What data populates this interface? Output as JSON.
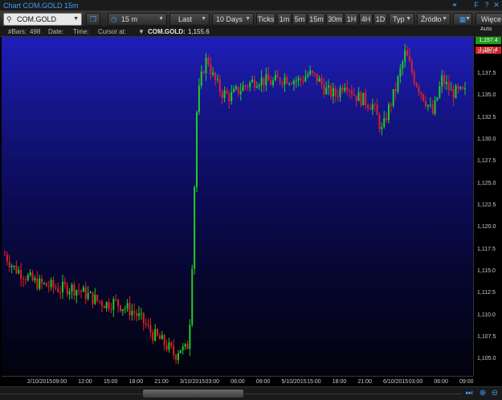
{
  "window": {
    "title": "Chart COM.GOLD 15m"
  },
  "toolbar": {
    "symbol": "COM.GOLD",
    "interval": "15 m",
    "price_type": "Last",
    "range": "10 Days",
    "ticks": "Ticks",
    "intervals": [
      "1m",
      "5m",
      "15m",
      "30m",
      "1H",
      "4H",
      "1D"
    ],
    "typ": "Typ",
    "source": "Źródło",
    "more": "Więce"
  },
  "infobar": {
    "bars_label": "#Bars:",
    "bars_value": "498",
    "date_label": "Date:",
    "time_label": "Time:",
    "cursor_label": "Cursor at:",
    "symbol": "COM.GOLD:",
    "symbol_value": "1,155.6"
  },
  "axis": {
    "auto": "Auto",
    "last_price_green": "1,157.4",
    "last_price_red": "1,157.4"
  },
  "colors": {
    "bull": "#22cc22",
    "bear": "#dd2222"
  },
  "chart_data": {
    "type": "candlestick",
    "y_ticks": [
      1105,
      1107.5,
      1110,
      1112.5,
      1115,
      1117.5,
      1120,
      1122.5,
      1125,
      1127.5,
      1130,
      1132.5,
      1135,
      1137.5,
      1140
    ],
    "y_tick_labels": [
      "1,105.0",
      "1,107.5",
      "1,110.0",
      "1,112.5",
      "1,115.0",
      "1,117.5",
      "1,120.0",
      "1,122.5",
      "1,125.0",
      "1,127.5",
      "1,130.0",
      "1,132.5",
      "1,135.0",
      "1,137.5",
      "1,140.0"
    ],
    "ylim": [
      1103.2,
      1141.8
    ],
    "x_tick_labels": [
      "2/10/2015",
      "09:00",
      "12:00",
      "15:00",
      "18:00",
      "21:00",
      "3/10/2015",
      "03:00",
      "06:00",
      "09:00",
      "5/10/2015",
      "15:00",
      "18:00",
      "21:00",
      "6/10/2015",
      "03:00",
      "06:00",
      "09:00"
    ],
    "close_path": [
      [
        0,
        1117.0
      ],
      [
        0.02,
        1115.5
      ],
      [
        0.04,
        1114.8
      ],
      [
        0.06,
        1114.0
      ],
      [
        0.08,
        1113.6
      ],
      [
        0.1,
        1113.4
      ],
      [
        0.12,
        1113.1
      ],
      [
        0.14,
        1113.3
      ],
      [
        0.16,
        1113.0
      ],
      [
        0.18,
        1112.4
      ],
      [
        0.2,
        1111.8
      ],
      [
        0.22,
        1111.4
      ],
      [
        0.24,
        1111.6
      ],
      [
        0.26,
        1111.0
      ],
      [
        0.28,
        1110.5
      ],
      [
        0.3,
        1109.4
      ],
      [
        0.32,
        1108.0
      ],
      [
        0.34,
        1107.2
      ],
      [
        0.36,
        1106.2
      ],
      [
        0.37,
        1105.5
      ],
      [
        0.38,
        1106.5
      ],
      [
        0.39,
        1106.0
      ],
      [
        0.4,
        1107.0
      ],
      [
        0.41,
        1120.0
      ],
      [
        0.415,
        1132.0
      ],
      [
        0.42,
        1135.0
      ],
      [
        0.43,
        1138.0
      ],
      [
        0.44,
        1139.5
      ],
      [
        0.45,
        1137.5
      ],
      [
        0.47,
        1135.5
      ],
      [
        0.49,
        1135.0
      ],
      [
        0.52,
        1136.2
      ],
      [
        0.55,
        1137.0
      ],
      [
        0.58,
        1136.6
      ],
      [
        0.61,
        1137.2
      ],
      [
        0.64,
        1136.8
      ],
      [
        0.66,
        1137.6
      ],
      [
        0.68,
        1137.0
      ],
      [
        0.7,
        1135.6
      ],
      [
        0.72,
        1135.2
      ],
      [
        0.74,
        1136.8
      ],
      [
        0.76,
        1135.2
      ],
      [
        0.78,
        1134.6
      ],
      [
        0.8,
        1134.0
      ],
      [
        0.82,
        1131.0
      ],
      [
        0.83,
        1133.0
      ],
      [
        0.85,
        1136.0
      ],
      [
        0.87,
        1140.0
      ],
      [
        0.89,
        1137.0
      ],
      [
        0.91,
        1135.0
      ],
      [
        0.93,
        1133.0
      ],
      [
        0.95,
        1137.0
      ],
      [
        0.97,
        1135.5
      ],
      [
        1.0,
        1135.4
      ]
    ]
  }
}
